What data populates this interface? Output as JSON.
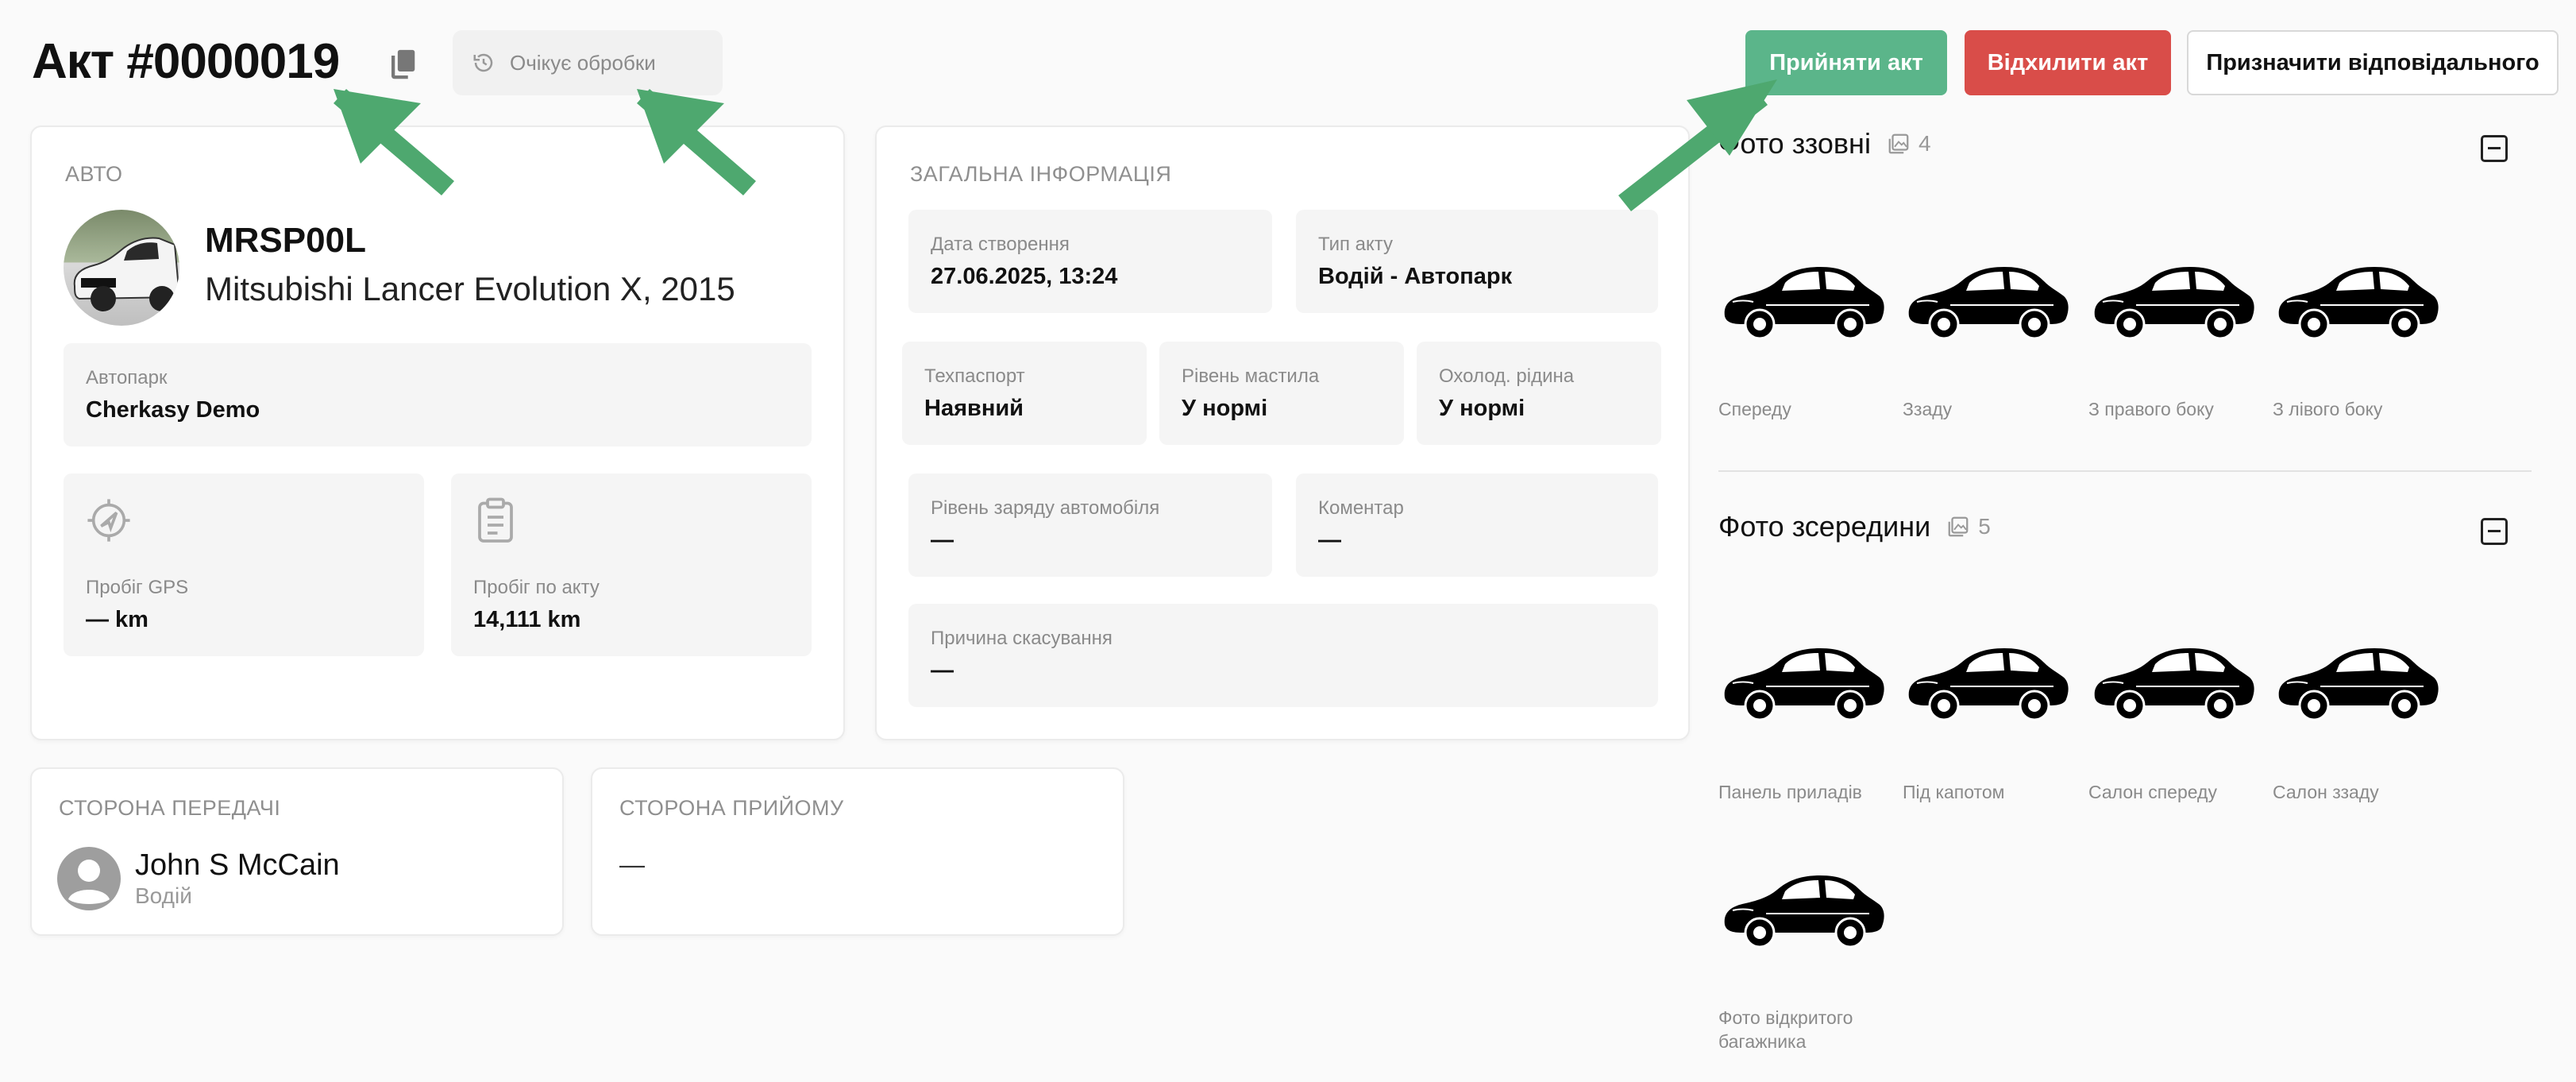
{
  "header": {
    "title": "Акт #0000019",
    "status": "Очікує обробки",
    "buttons": {
      "accept": "Прийняти акт",
      "reject": "Відхилити акт",
      "assign": "Призначити відповідального"
    }
  },
  "auto": {
    "section": "АВТО",
    "plate": "MRSP00L",
    "model": "Mitsubishi Lancer Evolution X, 2015",
    "fleet_label": "Автопарк",
    "fleet_value": "Cherkasy Demo",
    "gps_label": "Пробіг GPS",
    "gps_value": "— km",
    "act_mileage_label": "Пробіг по акту",
    "act_mileage_value": "14,111 km"
  },
  "general": {
    "section": "ЗАГАЛЬНА ІНФОРМАЦІЯ",
    "created_label": "Дата створення",
    "created_value": "27.06.2025, 13:24",
    "type_label": "Тип акту",
    "type_value": "Водій - Автопарк",
    "passport_label": "Техпаспорт",
    "passport_value": "Наявний",
    "oil_label": "Рівень мастила",
    "oil_value": "У нормі",
    "coolant_label": "Охолод. рідина",
    "coolant_value": "У нормі",
    "charge_label": "Рівень заряду автомобіля",
    "charge_value": "—",
    "comment_label": "Коментар",
    "comment_value": "—",
    "cancel_label": "Причина скасування",
    "cancel_value": "—"
  },
  "transfer": {
    "section": "СТОРОНА ПЕРЕДАЧІ",
    "name": "John S McCain",
    "role": "Водій"
  },
  "receive": {
    "section": "СТОРОНА ПРИЙОМУ",
    "value": "—"
  },
  "photos_outside": {
    "title": "Фото ззовні",
    "count": "4",
    "items": [
      "Спереду",
      "Ззаду",
      "З правого боку",
      "З лівого боку"
    ]
  },
  "photos_inside": {
    "title": "Фото зсередини",
    "count": "5",
    "items": [
      "Панель приладів",
      "Під капотом",
      "Салон спереду",
      "Салон ззаду",
      "Фото відкритого багажника"
    ]
  },
  "colors": {
    "accept": "#5bb58a",
    "reject": "#d94d49",
    "arrow": "#4ea86f"
  }
}
